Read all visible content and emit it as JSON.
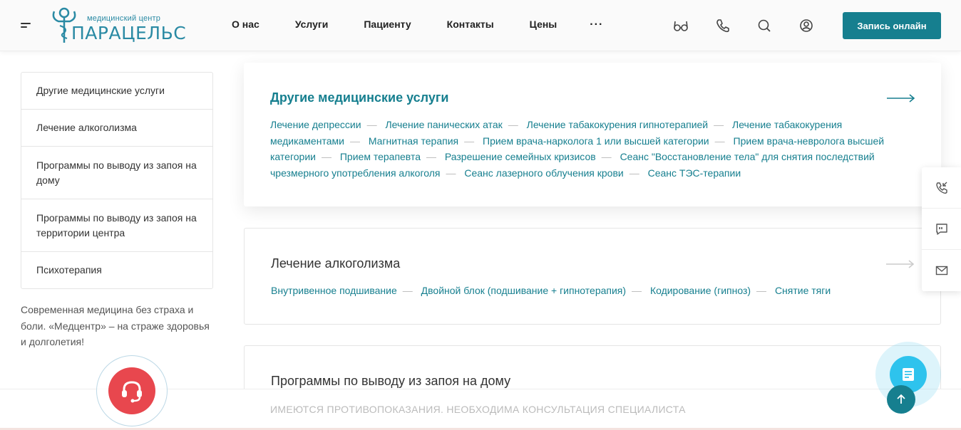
{
  "header": {
    "logo": {
      "small": "медицинский центр",
      "big": "ПАРАЦЕЛЬС"
    },
    "nav": [
      "О нас",
      "Услуги",
      "Пациенту",
      "Контакты",
      "Цены"
    ],
    "more": "···",
    "cta": "Запись онлайн"
  },
  "sidebar": {
    "items": [
      {
        "label": "Другие медицинские услуги"
      },
      {
        "label": "Лечение алкоголизма"
      },
      {
        "label": "Программы по выводу из запоя на дому"
      },
      {
        "label": "Программы по выводу из запоя на территории центра"
      },
      {
        "label": "Психотерапия"
      }
    ],
    "tagline": "Современная медицина без страха и боли. «Медцентр» – на страже здоровья и долголетия!"
  },
  "cards": [
    {
      "title": "Другие медицинские услуги",
      "links": [
        "Лечение депрессии",
        "Лечение панических атак",
        "Лечение табакокурения гипнотерапией",
        "Лечение табакокурения медикаментами",
        "Магнитная терапия",
        "Прием врача-нарколога 1 или высшей категории",
        "Прием врача-невролога высшей категории",
        "Прием терапевта",
        "Разрешение семейных кризисов",
        "Сеанс \"Восстановление тела\" для снятия последствий чрезмерного употребления алкоголя",
        "Сеанс лазерного облучения крови",
        "Сеанс ТЭС-терапии"
      ]
    },
    {
      "title": "Лечение алкоголизма",
      "links": [
        "Внутривенное подшивание",
        "Двойной блок (подшивание + гипнотерапия)",
        "Кодирование (гипноз)",
        "Снятие тяги"
      ]
    },
    {
      "title": "Программы по выводу из запоя на дому",
      "links": []
    }
  ],
  "footer": {
    "warning": "ИМЕЮТСЯ ПРОТИВОПОКАЗАНИЯ. НЕОБХОДИМА КОНСУЛЬТАЦИЯ СПЕЦИАЛИСТА"
  },
  "icons": {
    "header": [
      "glasses-icon",
      "phone-icon",
      "search-icon",
      "user-icon"
    ],
    "side": [
      "callback-icon",
      "chat-bubble-icon",
      "mail-icon"
    ]
  },
  "colors": {
    "accent": "#167f8f",
    "link": "#167f8f",
    "headset": "#e8474e",
    "chat": "#2ec3ed"
  }
}
